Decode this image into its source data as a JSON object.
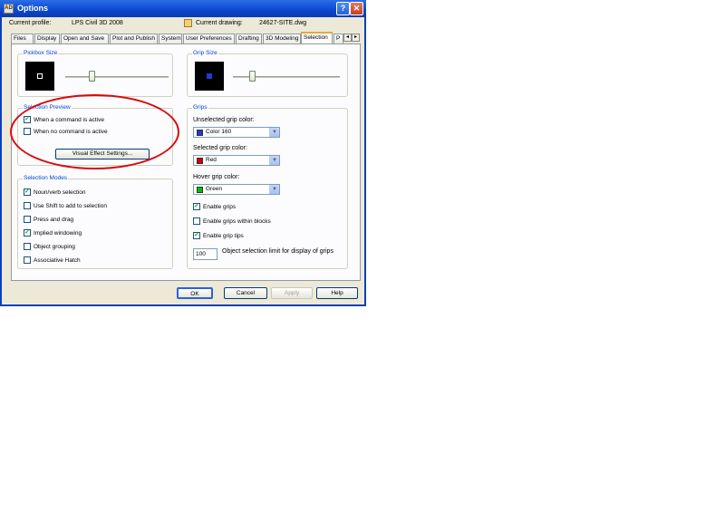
{
  "window": {
    "title": "Options",
    "app_icon": "AD",
    "help_button": "?",
    "close_button": "✕"
  },
  "profile": {
    "current_profile_label": "Current profile:",
    "current_profile_value": "LPS Civil 3D 2008",
    "current_drawing_label": "Current drawing:",
    "current_drawing_value": "24627-SITE.dwg"
  },
  "tabs": [
    "Files",
    "Display",
    "Open and Save",
    "Plot and Publish",
    "System",
    "User Preferences",
    "Drafting",
    "3D Modeling",
    "Selection",
    "P"
  ],
  "tab_scroll": {
    "left": "◂",
    "right": "▸"
  },
  "pickbox": {
    "label": "Pickbox Size"
  },
  "gripsize": {
    "label": "Grip Size"
  },
  "selection_preview": {
    "label": "Selection Preview",
    "when_active": "When a command is active",
    "when_none": "When no command is active",
    "visual_effect_button": "Visual Effect Settings..."
  },
  "selection_modes": {
    "label": "Selection Modes",
    "items": [
      "Noun/verb selection",
      "Use Shift to add to selection",
      "Press and drag",
      "Implied windowing",
      "Object grouping",
      "Associative Hatch"
    ],
    "checked": [
      true,
      false,
      false,
      true,
      false,
      false
    ]
  },
  "grips": {
    "label": "Grips",
    "unselected_label": "Unselected grip color:",
    "unselected_value": "Color 160",
    "selected_label": "Selected grip color:",
    "selected_value": "Red",
    "hover_label": "Hover grip color:",
    "hover_value": "Green",
    "enable_grips": "Enable grips",
    "enable_within_blocks": "Enable grips within blocks",
    "enable_tips": "Enable grip tips",
    "limit_value": "100",
    "limit_label": "Object selection limit for display of grips",
    "checked": [
      true,
      false,
      true
    ]
  },
  "colors": {
    "unselected": "#1f3ad0",
    "selected": "#d00000",
    "hover": "#00c000",
    "accent": "#0a3fbf"
  },
  "buttons": {
    "ok": "OK",
    "cancel": "Cancel",
    "apply": "Apply",
    "help": "Help"
  }
}
